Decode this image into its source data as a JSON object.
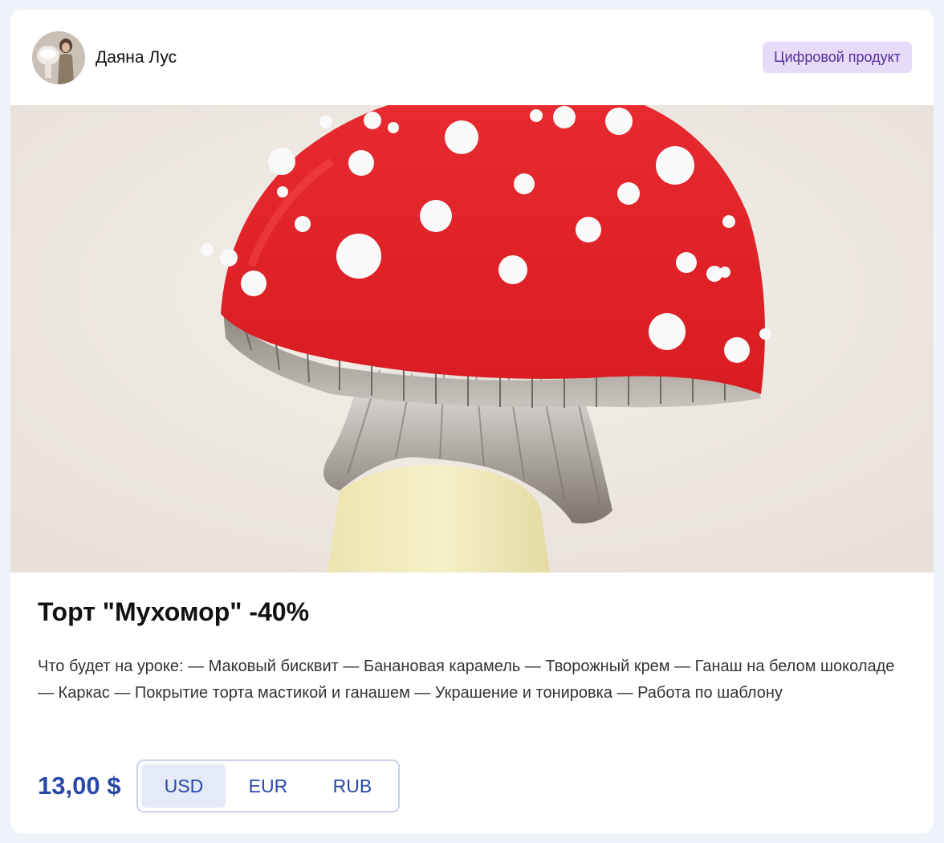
{
  "author": {
    "name": "Даяна Лус",
    "avatar_icon": "user-avatar"
  },
  "badge": "Цифровой продукт",
  "product": {
    "title": "Торт \"Мухомор\" -40%",
    "description": "Что будет на уроке: — Маковый бисквит — Банановая карамель — Творожный крем — Ганаш на белом шоколаде — Каркас — Покрытие торта мастикой и ганашем — Украшение и тонировка — Работа по шаблону",
    "price": "13,00 $"
  },
  "currencies": [
    {
      "label": "USD",
      "active": true
    },
    {
      "label": "EUR",
      "active": false
    },
    {
      "label": "RUB",
      "active": false
    }
  ],
  "colors": {
    "accent": "#2848a8",
    "badge_bg": "#e6dbf8",
    "badge_text": "#5a2f9a",
    "mushroom_cap": "#e8232a"
  }
}
